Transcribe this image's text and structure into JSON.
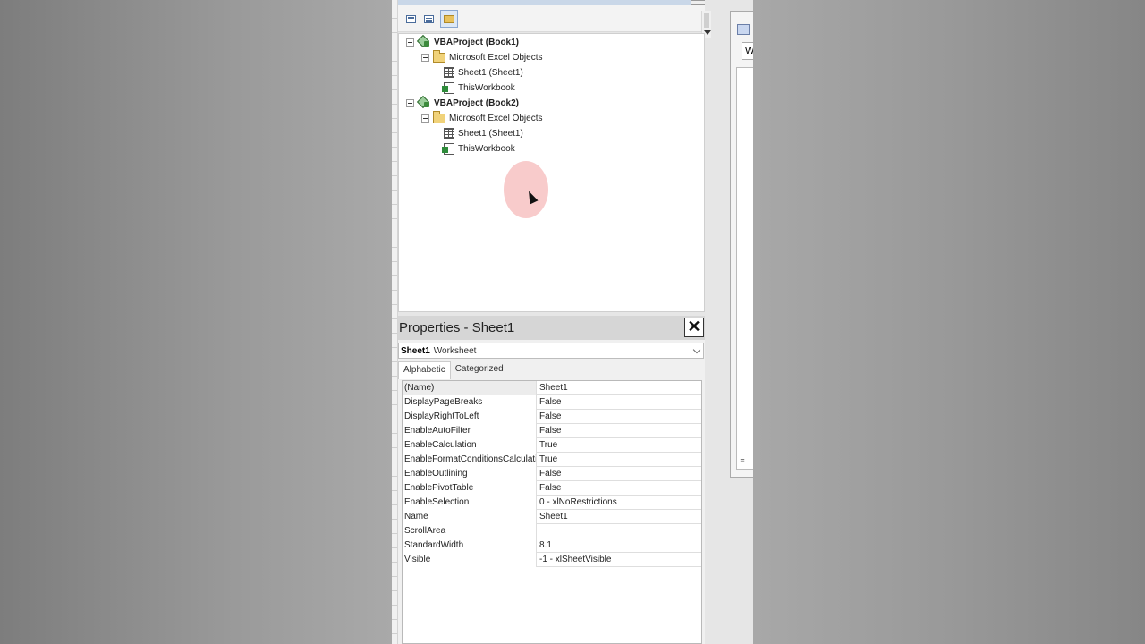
{
  "project_explorer": {
    "tree": [
      {
        "label": "VBAProject (Book1)",
        "level": 0,
        "kind": "project",
        "icon": "vba-project-icon"
      },
      {
        "label": "Microsoft Excel Objects",
        "level": 1,
        "kind": "folder",
        "icon": "folder-icon"
      },
      {
        "label": "Sheet1 (Sheet1)",
        "level": 2,
        "kind": "sheet",
        "icon": "worksheet-icon"
      },
      {
        "label": "ThisWorkbook",
        "level": 2,
        "kind": "workbook",
        "icon": "workbook-icon"
      },
      {
        "label": "VBAProject (Book2)",
        "level": 0,
        "kind": "project",
        "icon": "vba-project-icon"
      },
      {
        "label": "Microsoft Excel Objects",
        "level": 1,
        "kind": "folder",
        "icon": "folder-icon"
      },
      {
        "label": "Sheet1 (Sheet1)",
        "level": 2,
        "kind": "sheet",
        "icon": "worksheet-icon"
      },
      {
        "label": "ThisWorkbook",
        "level": 2,
        "kind": "workbook",
        "icon": "workbook-icon"
      }
    ]
  },
  "properties": {
    "title": "Properties - Sheet1",
    "close_glyph": "✕",
    "object_name": "Sheet1",
    "object_type": "Worksheet",
    "tabs": [
      {
        "label": "Alphabetic",
        "active": true
      },
      {
        "label": "Categorized",
        "active": false
      }
    ],
    "rows": [
      {
        "name": "(Name)",
        "value": "Sheet1"
      },
      {
        "name": "DisplayPageBreaks",
        "value": "False"
      },
      {
        "name": "DisplayRightToLeft",
        "value": "False"
      },
      {
        "name": "EnableAutoFilter",
        "value": "False"
      },
      {
        "name": "EnableCalculation",
        "value": "True"
      },
      {
        "name": "EnableFormatConditionsCalculation",
        "value": "True"
      },
      {
        "name": "EnableOutlining",
        "value": "False"
      },
      {
        "name": "EnablePivotTable",
        "value": "False"
      },
      {
        "name": "EnableSelection",
        "value": "0 - xlNoRestrictions"
      },
      {
        "name": "Name",
        "value": "Sheet1"
      },
      {
        "name": "ScrollArea",
        "value": ""
      },
      {
        "name": "StandardWidth",
        "value": "8.1"
      },
      {
        "name": "Visible",
        "value": "-1 - xlSheetVisible"
      }
    ]
  },
  "child_window": {
    "combo_text": "W",
    "scroll_glyph": "≡"
  },
  "colors": {
    "highlight": "#f08c8c",
    "title_bar": "#d6d6d6"
  }
}
